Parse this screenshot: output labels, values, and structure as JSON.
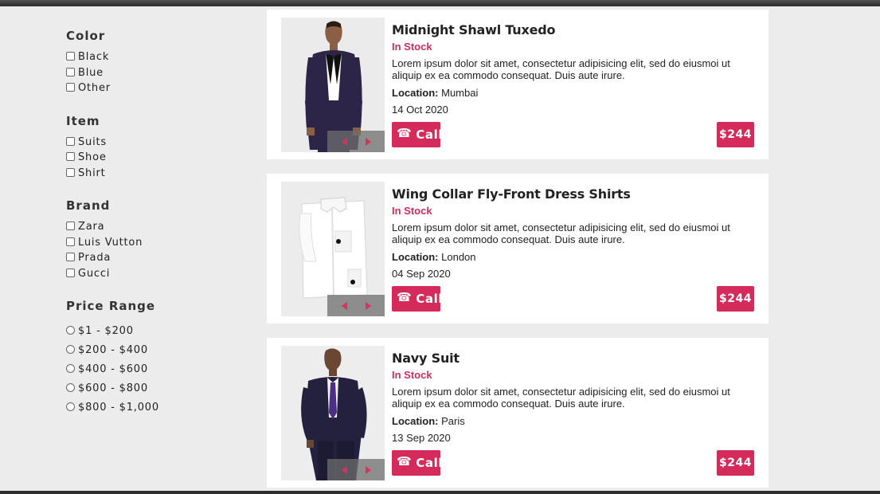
{
  "filters": {
    "color": {
      "title": "Color",
      "options": [
        "Black",
        "Blue",
        "Other"
      ]
    },
    "item": {
      "title": "Item",
      "options": [
        "Suits",
        "Shoe",
        "Shirt"
      ]
    },
    "brand": {
      "title": "Brand",
      "options": [
        "Zara",
        "Luis Vutton",
        "Prada",
        "Gucci"
      ]
    },
    "price": {
      "title": "Price Range",
      "options": [
        "$1 - $200",
        "$200 - $400",
        "$400 - $600",
        "$600 - $800",
        "$800 - $1,000"
      ]
    }
  },
  "products": [
    {
      "title": "Midnight Shawl Tuxedo",
      "stock": "In Stock",
      "description": "Lorem ipsum dolor sit amet, consectetur adipisicing elit, sed do eiusmoi ut aliquip ex ea commodo consequat. Duis aute irure.",
      "location_label": "Location:",
      "location": "Mumbai",
      "date": "14 Oct 2020",
      "call_label": "Call",
      "price": "$244"
    },
    {
      "title": "Wing Collar Fly-Front Dress Shirts",
      "stock": "In Stock",
      "description": "Lorem ipsum dolor sit amet, consectetur adipisicing elit, sed do eiusmoi ut aliquip ex ea commodo consequat. Duis aute irure.",
      "location_label": "Location:",
      "location": "London",
      "date": "04 Sep 2020",
      "call_label": "Call",
      "price": "$244"
    },
    {
      "title": "Navy Suit",
      "stock": "In Stock",
      "description": "Lorem ipsum dolor sit amet, consectetur adipisicing elit, sed do eiusmoi ut aliquip ex ea commodo consequat. Duis aute irure.",
      "location_label": "Location:",
      "location": "Paris",
      "date": "13 Sep 2020",
      "call_label": "Call",
      "price": "$244"
    }
  ],
  "icons": {
    "phone": "phone-icon",
    "prev": "arrow-left-icon",
    "next": "arrow-right-icon"
  },
  "colors": {
    "accent": "#d42b5b",
    "background": "#ececec",
    "card": "#ffffff"
  }
}
